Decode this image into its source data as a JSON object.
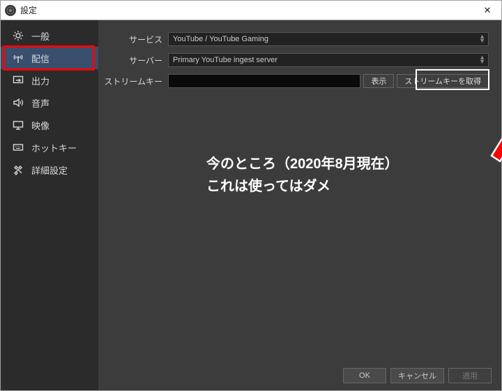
{
  "window": {
    "title": "設定",
    "close_glyph": "✕"
  },
  "sidebar": {
    "items": [
      {
        "label": "一般",
        "icon": "gear-icon"
      },
      {
        "label": "配信",
        "icon": "antenna-icon"
      },
      {
        "label": "出力",
        "icon": "monitor-arrow-icon"
      },
      {
        "label": "音声",
        "icon": "speaker-icon"
      },
      {
        "label": "映像",
        "icon": "monitor-icon"
      },
      {
        "label": "ホットキー",
        "icon": "keyboard-icon"
      },
      {
        "label": "詳細設定",
        "icon": "tools-icon"
      }
    ],
    "active_index": 1
  },
  "form": {
    "service_label": "サービス",
    "service_value": "YouTube / YouTube Gaming",
    "server_label": "サーバー",
    "server_value": "Primary YouTube ingest server",
    "stream_key_label": "ストリームキー",
    "stream_key_value": "",
    "show_button": "表示",
    "get_key_button": "ストリームキーを取得"
  },
  "annotation": {
    "line1": "今のところ（2020年8月現在）",
    "line2": "これは使ってはダメ"
  },
  "footer": {
    "ok": "OK",
    "cancel": "キャンセル",
    "apply": "適用"
  }
}
